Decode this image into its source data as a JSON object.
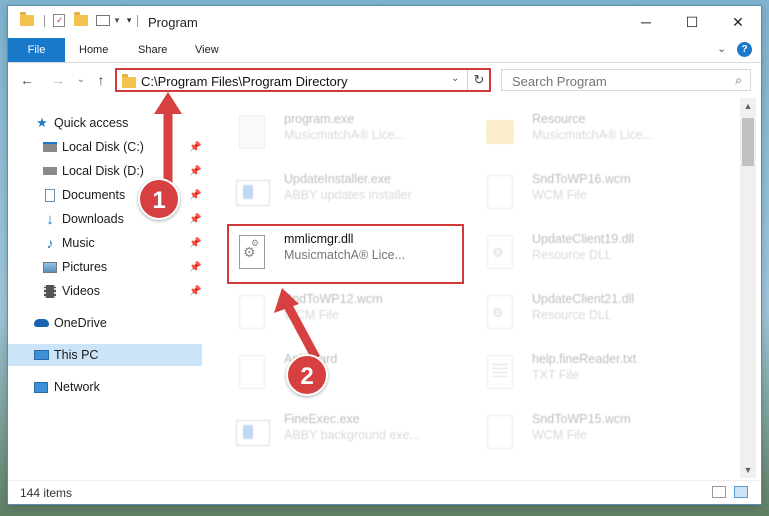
{
  "window": {
    "title": "Program",
    "controls": {
      "minimize": "─",
      "maximize": "☐",
      "close": "✕"
    }
  },
  "ribbon": {
    "tabs": [
      "File",
      "Home",
      "Share",
      "View"
    ],
    "expand_icon": "chevron-down-icon",
    "help_icon": "help-icon"
  },
  "nav_buttons": {
    "back": "←",
    "forward": "→",
    "history": "⌄",
    "up": "↑"
  },
  "address": {
    "path": "C:\\Program Files\\Program Directory",
    "dropdown": "⌄",
    "refresh": "↻"
  },
  "search": {
    "placeholder": "Search Program",
    "icon": "search-icon"
  },
  "sidebar": {
    "items": [
      {
        "label": "Quick access",
        "icon": "star-icon",
        "pinned": false
      },
      {
        "label": "Local Disk (C:)",
        "icon": "drive-icon",
        "pinned": true
      },
      {
        "label": "Local Disk (D:)",
        "icon": "drive-icon",
        "pinned": true
      },
      {
        "label": "Documents",
        "icon": "documents-icon",
        "pinned": true
      },
      {
        "label": "Downloads",
        "icon": "download-icon",
        "pinned": true
      },
      {
        "label": "Music",
        "icon": "music-icon",
        "pinned": true
      },
      {
        "label": "Pictures",
        "icon": "pictures-icon",
        "pinned": true
      },
      {
        "label": "Videos",
        "icon": "videos-icon",
        "pinned": true
      },
      {
        "label": "OneDrive",
        "icon": "cloud-icon",
        "pinned": false
      },
      {
        "label": "This PC",
        "icon": "computer-icon",
        "pinned": false,
        "selected": true
      },
      {
        "label": "Network",
        "icon": "network-icon",
        "pinned": false
      }
    ]
  },
  "files": [
    {
      "name": "program.exe",
      "desc": "MusicmatchA® Lice...",
      "icon": "exe-icon",
      "faded": true
    },
    {
      "name": "Resource",
      "desc": "MusicmatchA® Lice...",
      "icon": "folder-icon",
      "faded": true
    },
    {
      "name": "UpdateInstaller.exe",
      "desc": "ABBY updates installer",
      "icon": "exe-window-icon",
      "faded": true
    },
    {
      "name": "SndToWP16.wcm",
      "desc": "WCM File",
      "icon": "blank-file-icon",
      "faded": true
    },
    {
      "name": "mmlicmgr.dll",
      "desc": "MusicmatchA® Lice...",
      "icon": "dll-gear-icon",
      "faded": false,
      "highlighted": true
    },
    {
      "name": "UpdateClient19.dll",
      "desc": "Resource DLL",
      "icon": "dll-gear-icon",
      "faded": true
    },
    {
      "name": "SndToWP12.wcm",
      "desc": "WCM File",
      "icon": "blank-file-icon",
      "faded": true
    },
    {
      "name": "UpdateClient21.dll",
      "desc": "Resource DLL",
      "icon": "dll-gear-icon",
      "faded": true
    },
    {
      "name": "ApiAward",
      "desc": "",
      "icon": "blank-file-icon",
      "faded": true
    },
    {
      "name": "help.fineReader.txt",
      "desc": "TXT File",
      "icon": "text-file-icon",
      "faded": true
    },
    {
      "name": "FineExec.exe",
      "desc": "ABBY background exe...",
      "icon": "exe-window-icon",
      "faded": true
    },
    {
      "name": "SndToWP15.wcm",
      "desc": "WCM File",
      "icon": "blank-file-icon",
      "faded": true
    }
  ],
  "status": {
    "item_count": "144 items"
  },
  "callouts": {
    "step1": "1",
    "step2": "2"
  },
  "colors": {
    "accent": "#1979ca",
    "highlight": "#d23a3a",
    "selected": "#cce4f7"
  }
}
